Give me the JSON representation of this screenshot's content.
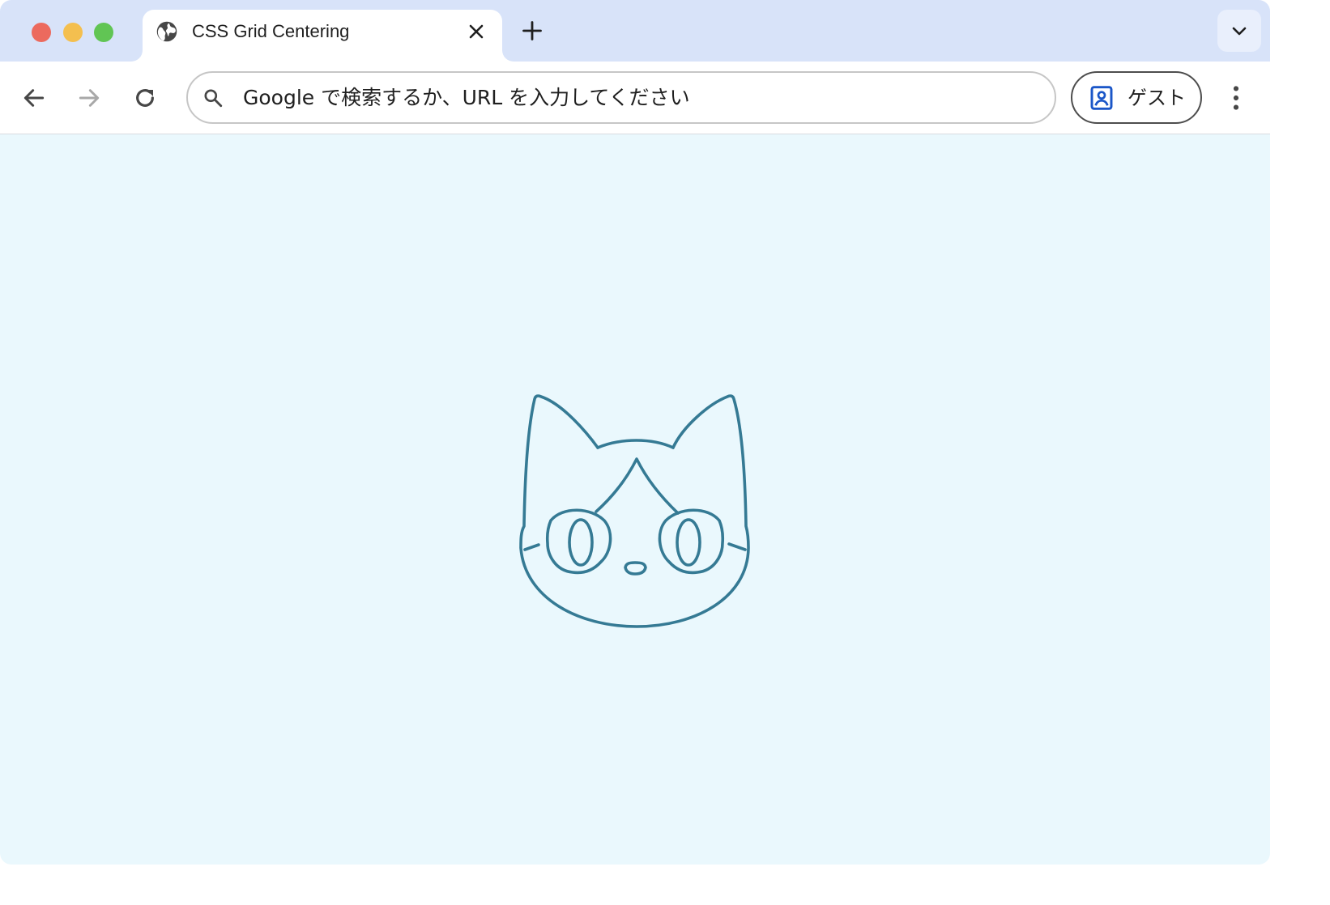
{
  "colors": {
    "tabstrip": "#d8e3f9",
    "content_background": "#eaf8fd",
    "illustration_stroke": "#357a94",
    "profile_accent": "#1a56c8"
  },
  "window": {
    "controls": [
      "close",
      "minimize",
      "zoom"
    ]
  },
  "tab": {
    "title": "CSS Grid Centering",
    "favicon": "globe-icon",
    "close_icon": "close-icon"
  },
  "tabstrip": {
    "new_tab_icon": "plus-icon",
    "tab_search_icon": "chevron-down-icon"
  },
  "toolbar": {
    "back_icon": "arrow-left-icon",
    "forward_icon": "arrow-right-icon",
    "reload_icon": "reload-icon",
    "menu_icon": "more-vert-icon"
  },
  "omnibox": {
    "placeholder": "Google で検索するか、URL を入力してください",
    "value": ""
  },
  "profile": {
    "label": "ゲスト",
    "icon": "person-badge-icon"
  },
  "page": {
    "illustration": "cat-face-icon"
  }
}
